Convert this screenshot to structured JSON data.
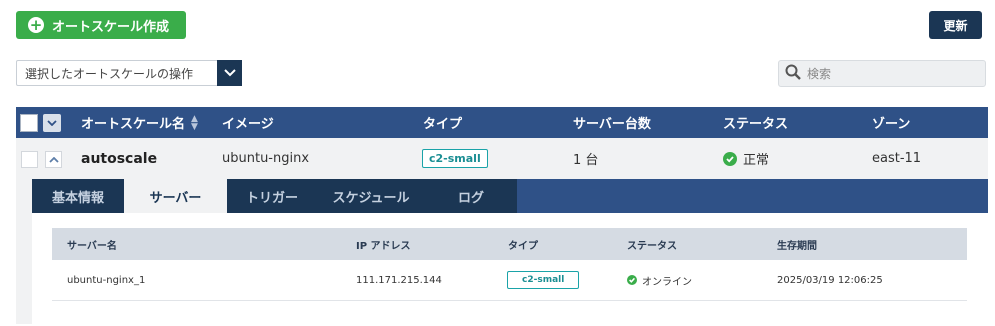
{
  "toolbar": {
    "create_label": "オートスケール作成",
    "refresh_label": "更新",
    "bulk_action_label": "選択したオートスケールの操作",
    "search_placeholder": "検索"
  },
  "table": {
    "columns": [
      "オートスケール名",
      "イメージ",
      "タイプ",
      "サーバー台数",
      "ステータス",
      "ゾーン"
    ],
    "rows": [
      {
        "name": "autoscale",
        "image": "ubuntu-nginx",
        "type": "c2-small",
        "server_count": "1 台",
        "status": "正常",
        "zone": "east-11"
      }
    ]
  },
  "detail": {
    "tabs": [
      "基本情報",
      "サーバー",
      "トリガー",
      "スケジュール",
      "ログ"
    ],
    "active_tab": "サーバー",
    "servers": {
      "columns": [
        "サーバー名",
        "IP アドレス",
        "タイプ",
        "ステータス",
        "生存期間"
      ],
      "rows": [
        {
          "name": "ubuntu-nginx_1",
          "ip": "111.171.215.144",
          "type": "c2-small",
          "status": "オンライン",
          "lifetime": "2025/03/19 12:06:25"
        }
      ]
    }
  },
  "colors": {
    "accent_green": "#3aad4a",
    "navy": "#1b3654",
    "header_blue": "#2f5187",
    "teal_badge": "#1aa3a8"
  }
}
